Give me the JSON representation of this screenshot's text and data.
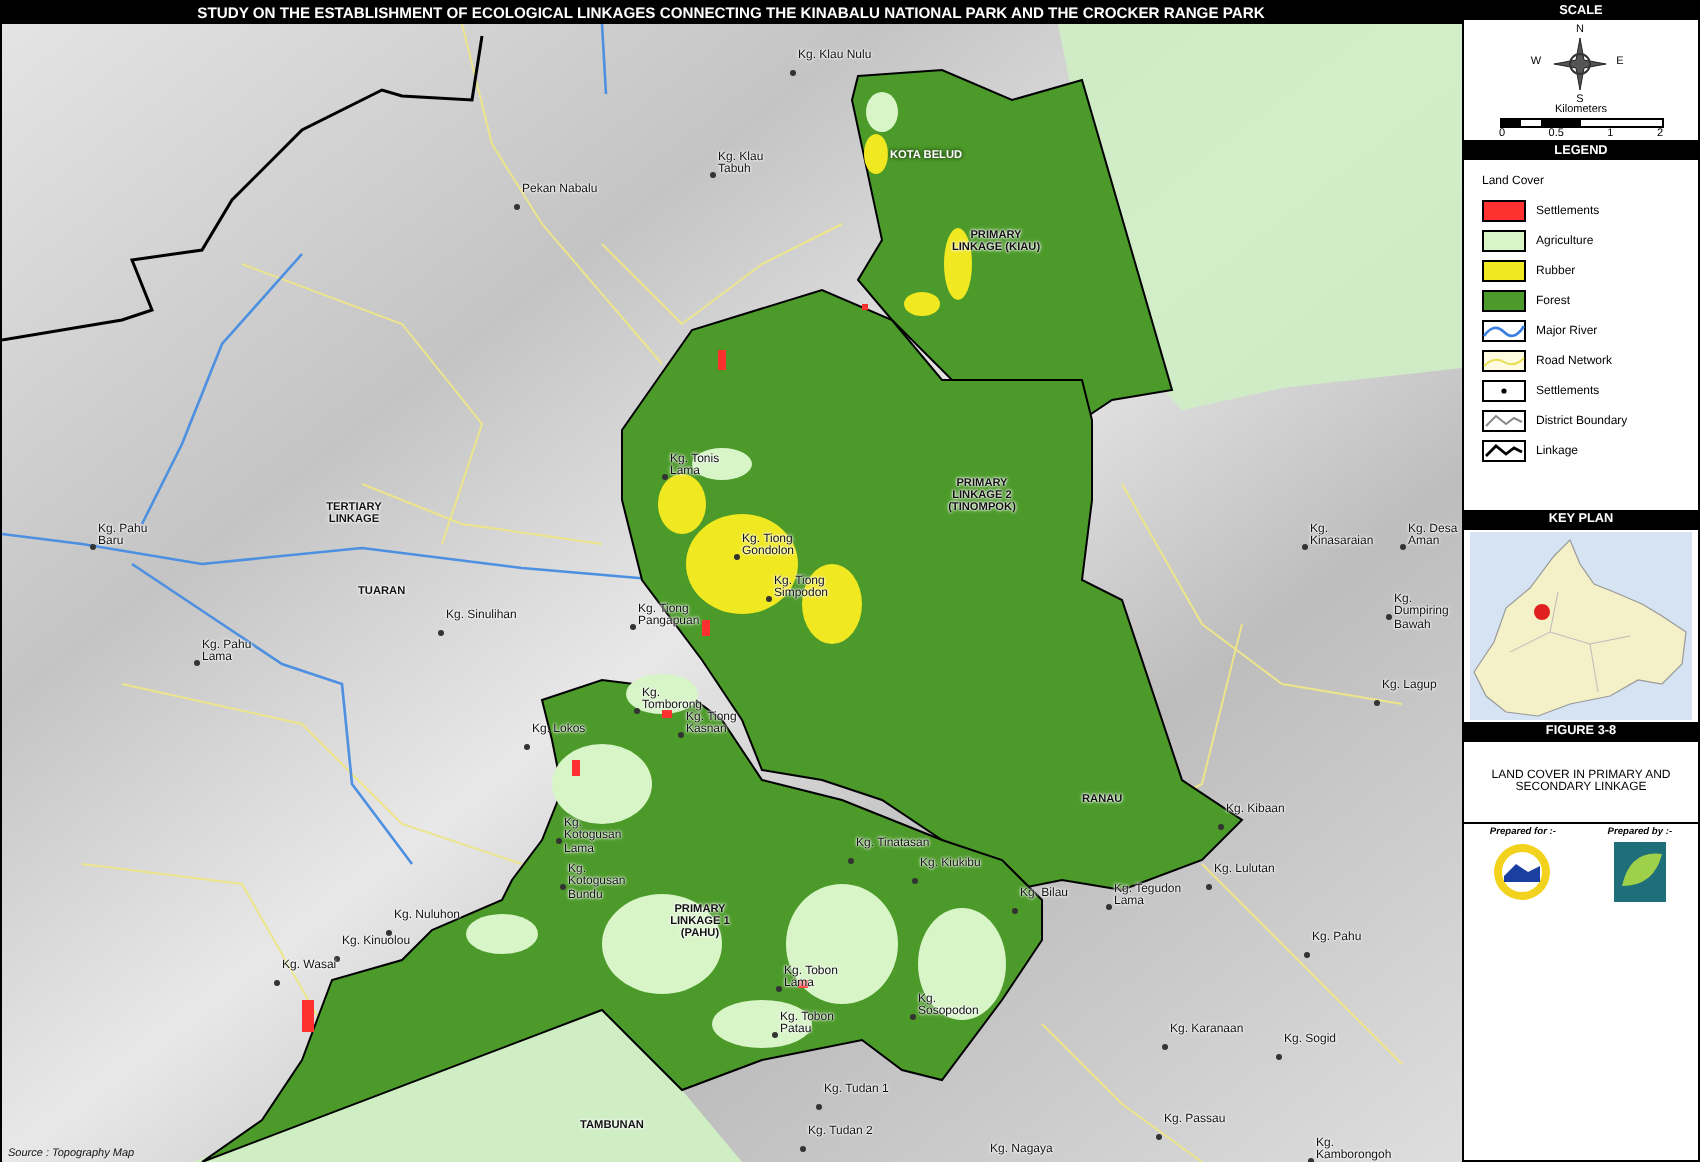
{
  "title": "STUDY ON THE ESTABLISHMENT OF ECOLOGICAL LINKAGES CONNECTING THE KINABALU NATIONAL PARK AND THE CROCKER RANGE PARK",
  "map": {
    "labels": [
      {
        "kind": "village",
        "text": "Kg. Klau Nulu"
      },
      {
        "kind": "village",
        "text": "Kg. Klau Tabuh"
      },
      {
        "kind": "village",
        "text": "Pekan Nabalu"
      },
      {
        "kind": "district",
        "text": "KOTA BELUD"
      },
      {
        "kind": "linkage",
        "text": "PRIMARY LINKAGE (KIAU)"
      },
      {
        "kind": "linkage",
        "text": "PRIMARY LINKAGE 2 (TINOMPOK)"
      },
      {
        "kind": "linkage",
        "text": "TERTIARY LINKAGE"
      },
      {
        "kind": "village",
        "text": "Kg. Pahu Baru"
      },
      {
        "kind": "village",
        "text": "Kg. Tonis Lama"
      },
      {
        "kind": "village",
        "text": "Kg. Tiong Gondolon"
      },
      {
        "kind": "area",
        "text": "TUARAN"
      },
      {
        "kind": "village",
        "text": "Kg. Sinulihan"
      },
      {
        "kind": "village",
        "text": "Kg. Pahu Lama"
      },
      {
        "kind": "village",
        "text": "Kg. Tiong Pangapuan"
      },
      {
        "kind": "village",
        "text": "Kg. Tiong Simpodon"
      },
      {
        "kind": "village",
        "text": "Kg. Kinasaraian"
      },
      {
        "kind": "village",
        "text": "Kg. Desa Aman"
      },
      {
        "kind": "village",
        "text": "Kg. Dumpiring Bawah"
      },
      {
        "kind": "village",
        "text": "Kg. Lagup"
      },
      {
        "kind": "village",
        "text": "Kg. Tomborong"
      },
      {
        "kind": "village",
        "text": "Kg. Lokos"
      },
      {
        "kind": "village",
        "text": "Kg. Tiong Kasnan"
      },
      {
        "kind": "village",
        "text": "Kg. Kotogusan Lama"
      },
      {
        "kind": "village",
        "text": "Kg. Kotogusan Bundu"
      },
      {
        "kind": "area",
        "text": "RANAU"
      },
      {
        "kind": "village",
        "text": "Kg. Kibaan"
      },
      {
        "kind": "village",
        "text": "Kg. Tinatasan"
      },
      {
        "kind": "village",
        "text": "Kg. Kiukibu"
      },
      {
        "kind": "village",
        "text": "Kg. Bilau"
      },
      {
        "kind": "village",
        "text": "Kg. Tegudon Lama"
      },
      {
        "kind": "village",
        "text": "Kg. Lulutan"
      },
      {
        "kind": "linkage",
        "text": "PRIMARY LINKAGE 1 (PAHU)"
      },
      {
        "kind": "village",
        "text": "Kg. Pahu"
      },
      {
        "kind": "village",
        "text": "Kg. Nuluhon"
      },
      {
        "kind": "village",
        "text": "Kg. Kinuolou"
      },
      {
        "kind": "village",
        "text": "Kg. Wasai"
      },
      {
        "kind": "village",
        "text": "Kg. Tobon Lama"
      },
      {
        "kind": "village",
        "text": "Kg. Tobon Patau"
      },
      {
        "kind": "village",
        "text": "Kg. Sosopodon"
      },
      {
        "kind": "village",
        "text": "Kg. Karanaan"
      },
      {
        "kind": "village",
        "text": "Kg. Sogid"
      },
      {
        "kind": "village",
        "text": "Kg. Tudan 1"
      },
      {
        "kind": "village",
        "text": "Kg. Tudan 2"
      },
      {
        "kind": "village",
        "text": "Kg. Nagaya"
      },
      {
        "kind": "village",
        "text": "Kg. Passau"
      },
      {
        "kind": "village",
        "text": "Kg. Kamborongoh"
      },
      {
        "kind": "area",
        "text": "TAMBUNAN"
      }
    ],
    "source": "Source : Topography Map"
  },
  "panel": {
    "scale": {
      "heading": "SCALE",
      "compass_labels": [
        "N",
        "E",
        "S",
        "W"
      ],
      "unit": "Kilometers",
      "ticks": [
        "0",
        "0.5",
        "1",
        "2"
      ]
    },
    "legend": {
      "heading": "LEGEND",
      "group": "Land Cover",
      "items": [
        {
          "kind": "fill",
          "label": "Settlements",
          "color": "#ff3030"
        },
        {
          "kind": "fill",
          "label": "Agriculture",
          "color": "#d8f5c8"
        },
        {
          "kind": "fill",
          "label": "Rubber",
          "color": "#f0e820"
        },
        {
          "kind": "fill",
          "label": "Forest",
          "color": "#4c9a2a"
        },
        {
          "kind": "river",
          "label": "Major River"
        },
        {
          "kind": "road",
          "label": "Road Network"
        },
        {
          "kind": "point",
          "label": "Settlements"
        },
        {
          "kind": "district",
          "label": "District Boundary"
        },
        {
          "kind": "linkage",
          "label": "Linkage"
        }
      ]
    },
    "key_plan": {
      "heading": "KEY PLAN"
    },
    "figure": {
      "heading": "FIGURE 3-8",
      "caption": "LAND COVER IN PRIMARY AND SECONDARY LINKAGE"
    },
    "prepared_for": "Prepared for :-",
    "prepared_by": "Prepared by :-"
  }
}
